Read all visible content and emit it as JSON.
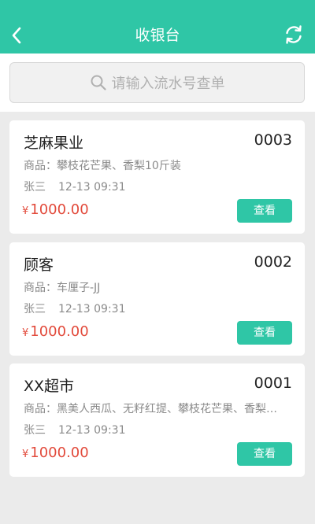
{
  "header": {
    "title": "收银台",
    "back_icon": "chevron-left-icon",
    "refresh_icon": "refresh-icon",
    "accent": "#2fc6a6"
  },
  "search": {
    "placeholder": "请输入流水号查单",
    "icon": "search-icon"
  },
  "orders": [
    {
      "name": "芝麻果业",
      "serial": "0003",
      "goods": "商品：攀枝花芒果、香梨10斤装",
      "cashier": "张三",
      "time": "12-13 09:31",
      "currency": "¥",
      "amount": "1000.00",
      "button": "查看"
    },
    {
      "name": "顾客",
      "serial": "0002",
      "goods": "商品：车厘子-JJ",
      "cashier": "张三",
      "time": "12-13 09:31",
      "currency": "¥",
      "amount": "1000.00",
      "button": "查看"
    },
    {
      "name": "XX超市",
      "serial": "0001",
      "goods": "商品：黑美人西瓜、无籽红提、攀枝花芒果、香梨…",
      "cashier": "张三",
      "time": "12-13 09:31",
      "currency": "¥",
      "amount": "1000.00",
      "button": "查看"
    }
  ],
  "colors": {
    "price": "#e24a3b",
    "background": "#ebebeb"
  }
}
